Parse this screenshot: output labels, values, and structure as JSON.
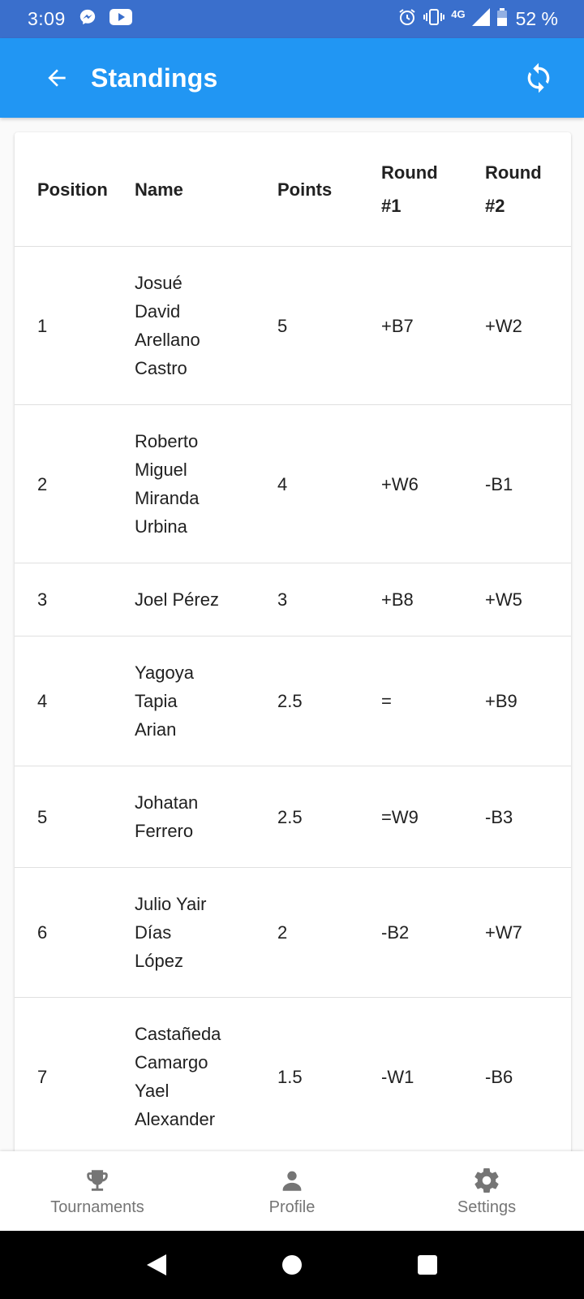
{
  "status_bar": {
    "time": "3:09",
    "network": "4G",
    "battery": "52 %",
    "icons": [
      "messenger-icon",
      "youtube-icon",
      "alarm-icon",
      "vibrate-icon",
      "signal-icon",
      "battery-icon"
    ]
  },
  "app_bar": {
    "title": "Standings",
    "back_icon": "arrow-back-icon",
    "refresh_icon": "sync-icon"
  },
  "table": {
    "headers": {
      "position": "Position",
      "name": "Name",
      "points": "Points",
      "round1": [
        "Round",
        "#1"
      ],
      "round2": [
        "Round",
        "#2"
      ]
    },
    "rows": [
      {
        "position": "1",
        "name": [
          "Josué",
          "David",
          "Arellano",
          "Castro"
        ],
        "points": "5",
        "round1": "+B7",
        "round2": "+W2"
      },
      {
        "position": "2",
        "name": [
          "Roberto",
          "Miguel",
          "Miranda",
          "Urbina"
        ],
        "points": "4",
        "round1": "+W6",
        "round2": "-B1"
      },
      {
        "position": "3",
        "name": [
          "Joel Pérez"
        ],
        "points": "3",
        "round1": "+B8",
        "round2": "+W5"
      },
      {
        "position": "4",
        "name": [
          "Yagoya",
          "Tapia",
          "Arian"
        ],
        "points": "2.5",
        "round1": "=",
        "round2": "+B9"
      },
      {
        "position": "5",
        "name": [
          "Johatan",
          "Ferrero"
        ],
        "points": "2.5",
        "round1": "=W9",
        "round2": "-B3"
      },
      {
        "position": "6",
        "name": [
          "Julio Yair",
          "Días",
          "López"
        ],
        "points": "2",
        "round1": "-B2",
        "round2": "+W7"
      },
      {
        "position": "7",
        "name": [
          "Castañeda",
          "Camargo",
          "Yael",
          "Alexander"
        ],
        "points": "1.5",
        "round1": "-W1",
        "round2": "-B6"
      }
    ]
  },
  "bottom_nav": {
    "items": [
      {
        "label": "Tournaments",
        "icon": "trophy-icon"
      },
      {
        "label": "Profile",
        "icon": "person-icon"
      },
      {
        "label": "Settings",
        "icon": "gear-icon"
      }
    ]
  },
  "colors": {
    "status_bar": "#3a6fcc",
    "app_bar": "#2196f3",
    "nav_inactive": "#757575"
  }
}
